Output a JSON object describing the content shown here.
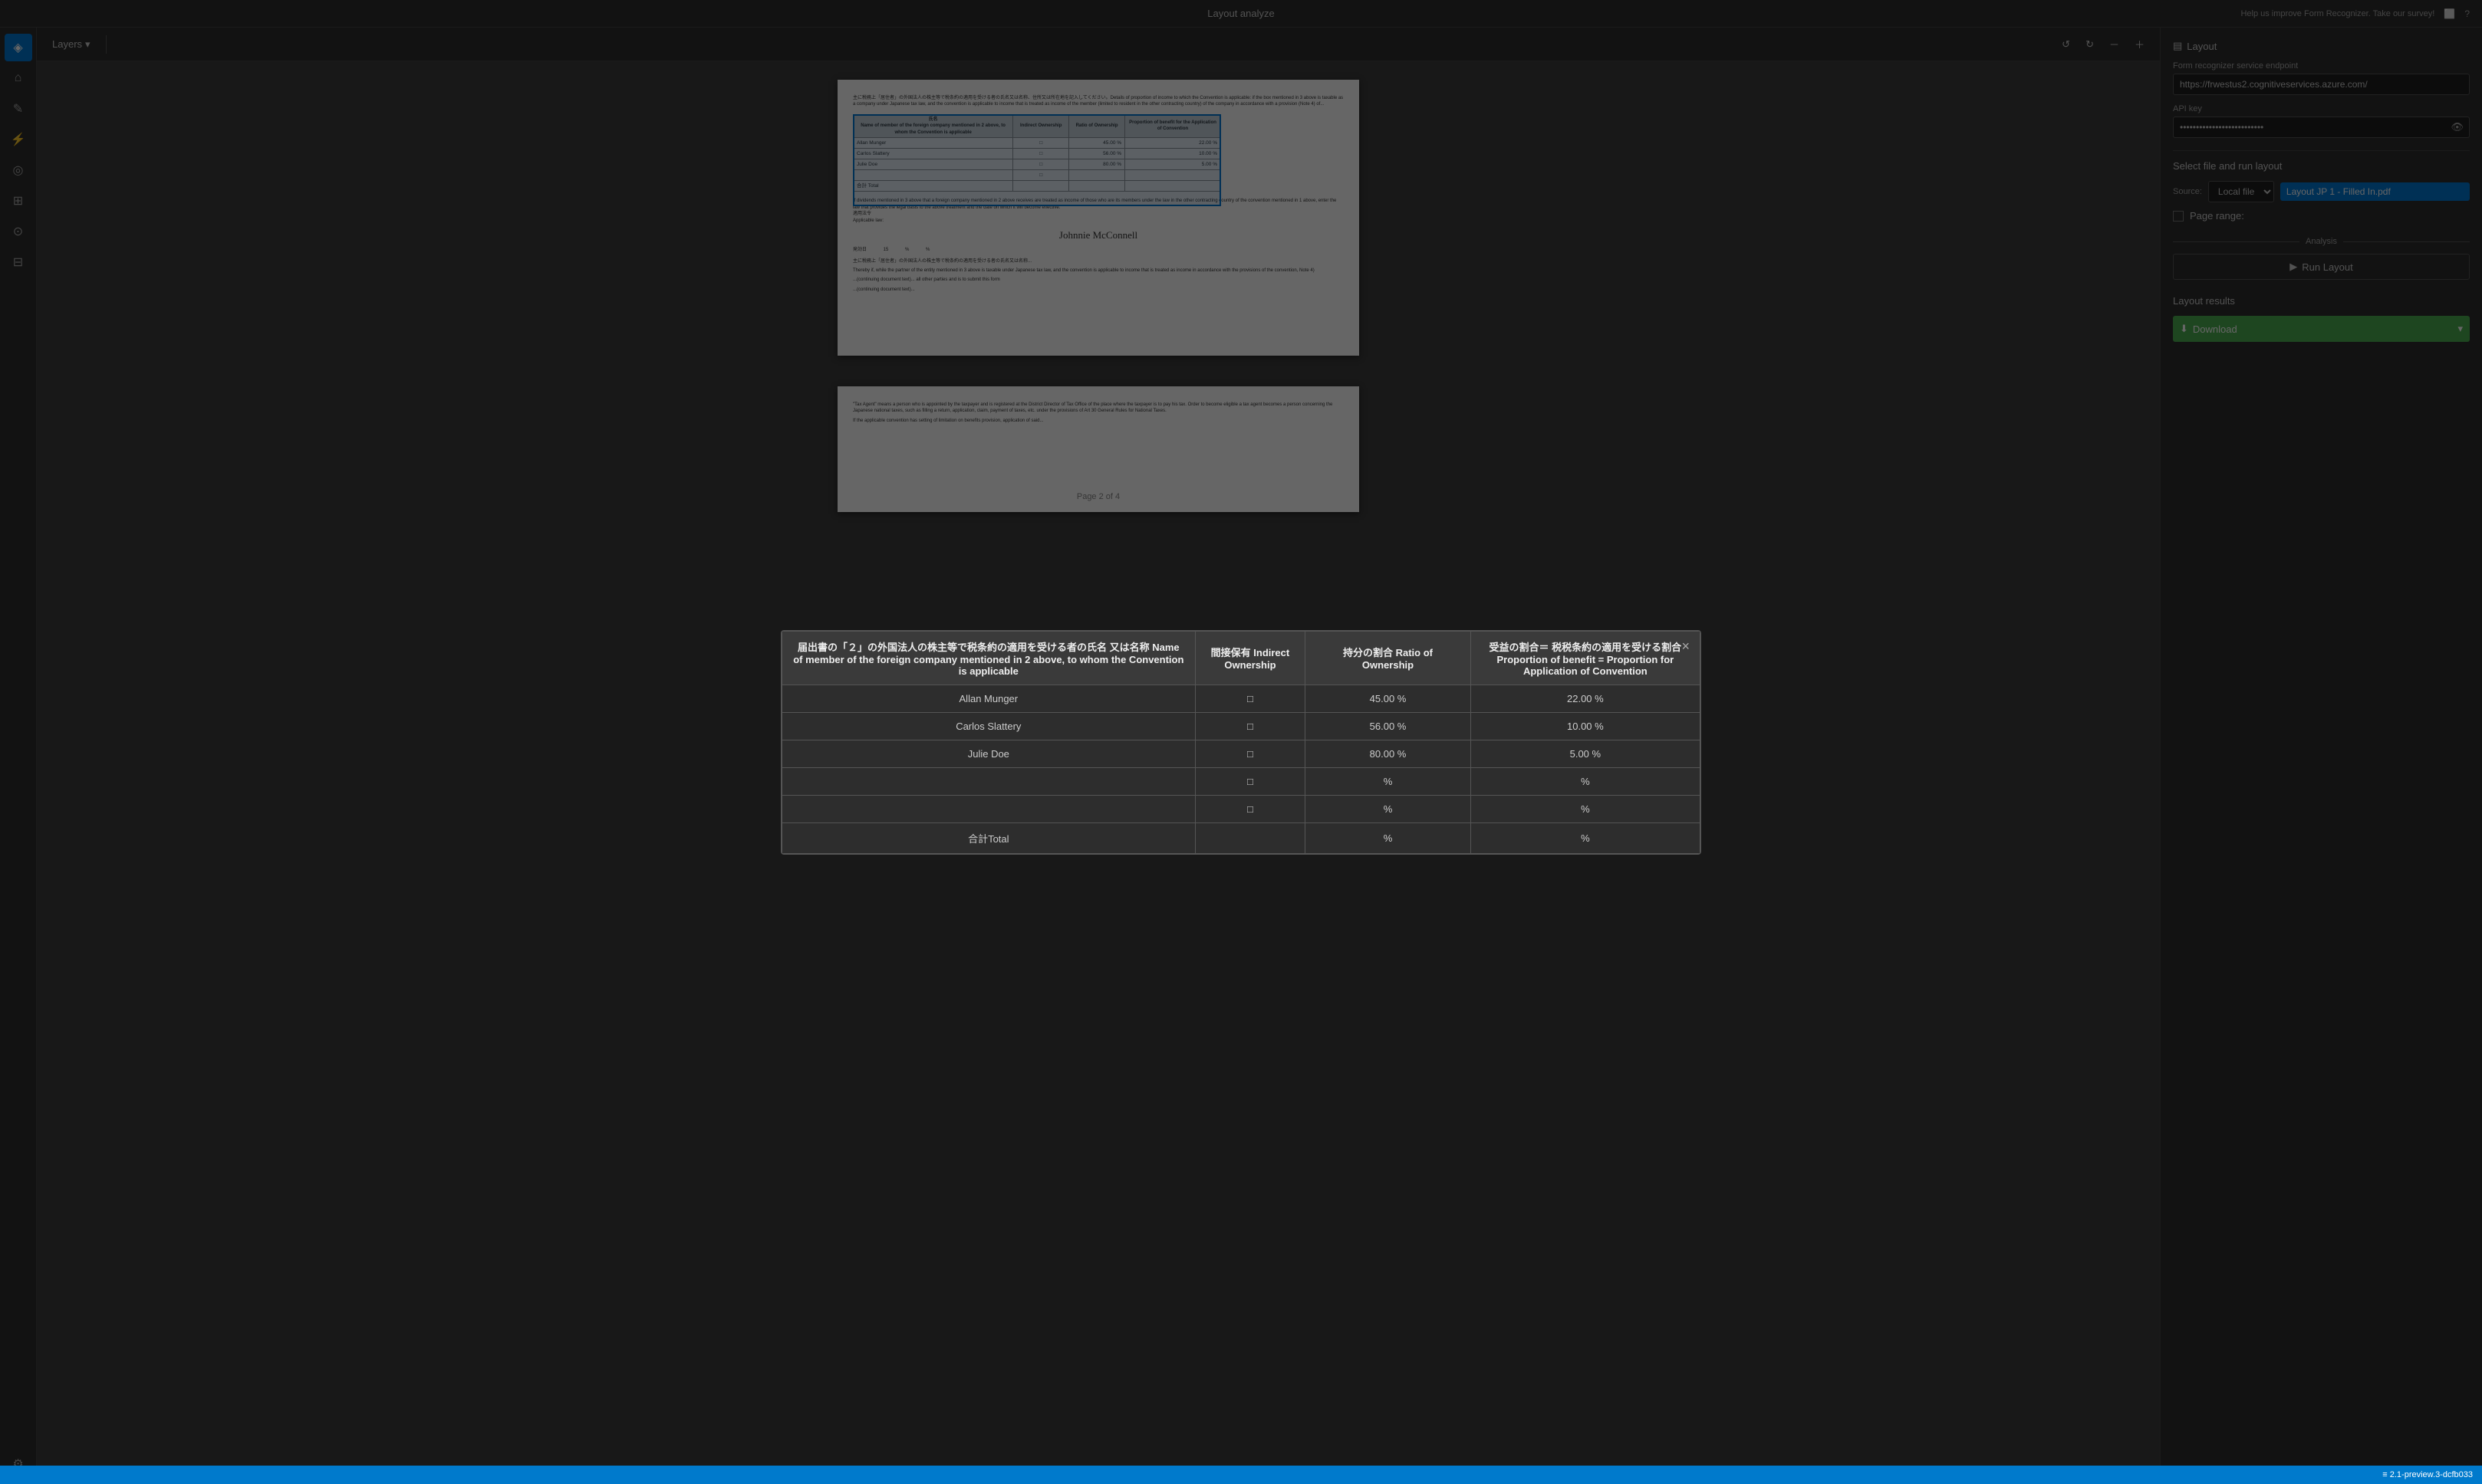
{
  "app": {
    "title": "Layout analyze",
    "status_bar": "≡ 2.1-preview.3-dcfb033",
    "help_text": "Help us improve Form Recognizer. Take our survey!"
  },
  "sidebar": {
    "icons": [
      {
        "name": "logo-icon",
        "symbol": "◈",
        "active": true
      },
      {
        "name": "home-icon",
        "symbol": "⌂",
        "active": false
      },
      {
        "name": "label-icon",
        "symbol": "✎",
        "active": false
      },
      {
        "name": "train-icon",
        "symbol": "⚡",
        "active": false
      },
      {
        "name": "predict-icon",
        "symbol": "◎",
        "active": false
      },
      {
        "name": "layers-icon",
        "symbol": "⊞",
        "active": false
      },
      {
        "name": "model-icon",
        "symbol": "⚙",
        "active": false
      },
      {
        "name": "compose-icon",
        "symbol": "⊟",
        "active": false
      },
      {
        "name": "settings-icon",
        "symbol": "⚙",
        "bottom": true
      }
    ]
  },
  "toolbar": {
    "layers_label": "Layers",
    "undo_title": "Undo",
    "redo_title": "Redo",
    "zoom_out_title": "Zoom out",
    "zoom_in_title": "Zoom in"
  },
  "right_panel": {
    "layout_title": "Layout",
    "form_recognizer_label": "Form recognizer service endpoint",
    "endpoint_value": "https://frwestus2.cognitiveservices.azure.com/",
    "api_key_label": "API key",
    "api_key_value": "••••••••••••••••••••••••••",
    "select_file_title": "Select file and run layout",
    "source_label": "Source:",
    "source_option": "Local file",
    "file_name": "Layout JP 1 - Filled In.pdf",
    "page_range_label": "Page range:",
    "page_range_checked": false,
    "analysis_label": "Analysis",
    "run_layout_label": "Run Layout",
    "layout_results_title": "Layout results",
    "download_label": "Download",
    "download_arrow": "▾"
  },
  "modal": {
    "close_label": "×",
    "headers": [
      "届出書の「２」の外国法人の株主等で税条約の適用を受ける者の氏名 又は名称 Name of member of the foreign company mentioned in 2 above, to whom the Convention is applicable",
      "間接保有 Indirect Ownership",
      "持分の割合 Ratio of Ownership",
      "受益の割合＝ 税税条約の適用を受ける割合 Proportion of benefit = Proportion for Application of Convention"
    ],
    "rows": [
      {
        "name": "Allan Munger",
        "checkbox": "□",
        "ratio": "45.00 %",
        "benefit": "22.00 %"
      },
      {
        "name": "Carlos Slattery",
        "checkbox": "□",
        "ratio": "56.00 %",
        "benefit": "10.00 %"
      },
      {
        "name": "Julie Doe",
        "checkbox": "□",
        "ratio": "80.00 %",
        "benefit": "5.00 %"
      },
      {
        "name": "",
        "checkbox": "□",
        "ratio": "%",
        "benefit": "%"
      },
      {
        "name": "",
        "checkbox": "□",
        "ratio": "%",
        "benefit": "%"
      },
      {
        "name": "合計Total",
        "checkbox": "",
        "ratio": "%",
        "benefit": "%"
      }
    ]
  },
  "document": {
    "page_label": "Page 2 of 4"
  }
}
